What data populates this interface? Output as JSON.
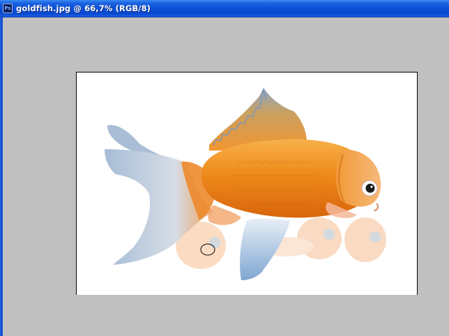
{
  "window": {
    "title": "goldfish.jpg @ 66,7% (RGB/8)",
    "app_icon_label": "Ps"
  },
  "document": {
    "image_name": "goldfish",
    "background_color": "#ffffff"
  },
  "colors": {
    "titlebar": "#0b4fd8",
    "workspace": "#c0c0c0",
    "fish_orange": "#f08a1c",
    "fin_blue": "#b8cce0"
  }
}
